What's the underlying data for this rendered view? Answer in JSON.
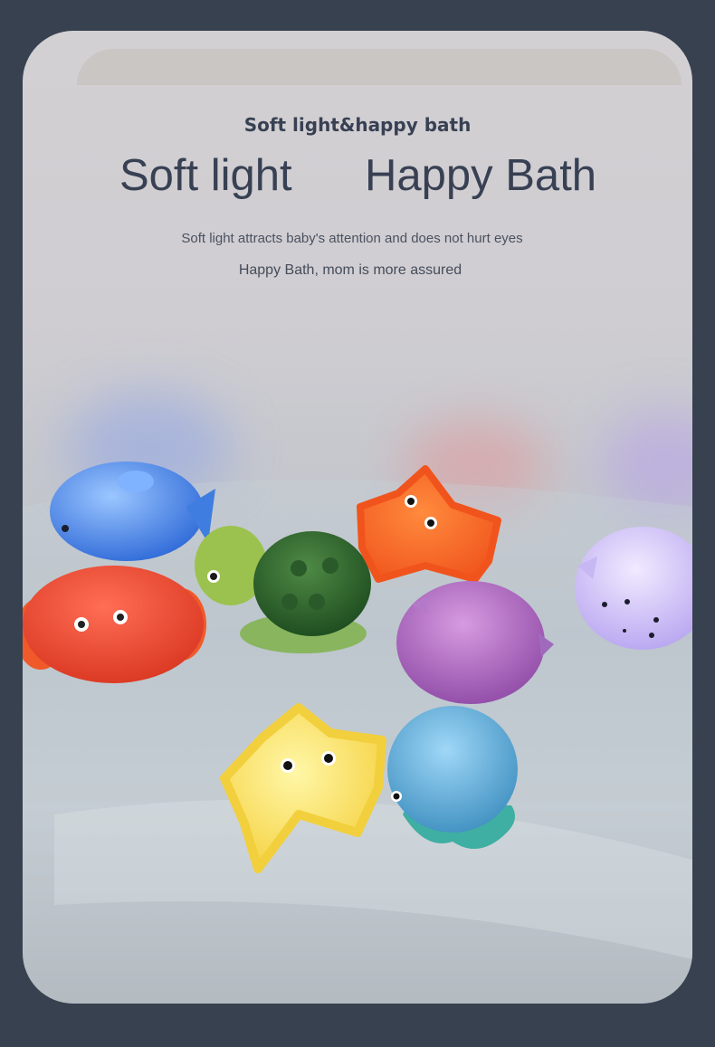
{
  "header": {
    "subtitle": "Soft light&happy bath",
    "title_left": "Soft light",
    "title_right": "Happy Bath",
    "description_1": "Soft light attracts baby's attention and does not hurt eyes",
    "description_2": "Happy Bath, mom is more assured"
  },
  "colors": {
    "page_background": "#374150",
    "card_background": "#cfcdd2",
    "text": "#384153"
  },
  "toys": [
    "blue-fish",
    "red-crab",
    "green-turtle",
    "orange-starfish",
    "purple-pufferfish",
    "lilac-seal",
    "yellow-starfish",
    "teal-octopus"
  ]
}
